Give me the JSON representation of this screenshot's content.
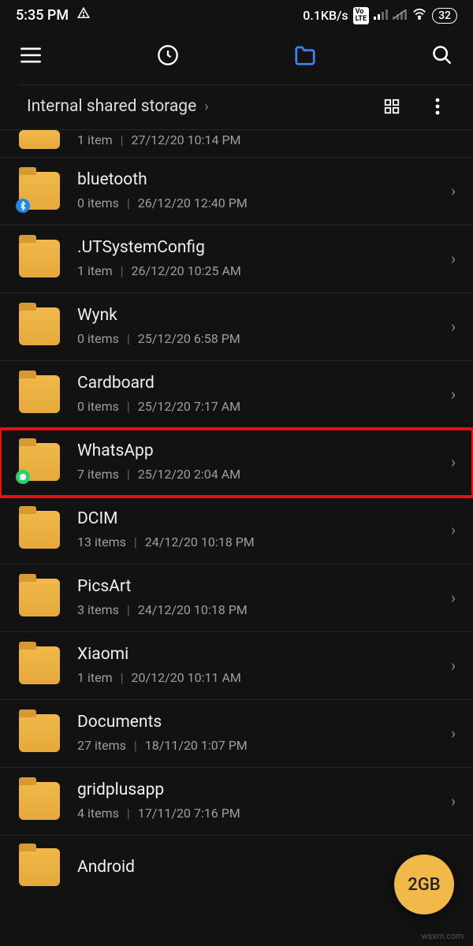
{
  "statusbar": {
    "time": "5:35 PM",
    "net_speed": "0.1KB/s",
    "battery": "32"
  },
  "breadcrumb": {
    "path": "Internal shared storage"
  },
  "items": [
    {
      "name": "",
      "meta_items": "1 item",
      "meta_date": "27/12/20 10:14 PM",
      "partial": true
    },
    {
      "name": "bluetooth",
      "meta_items": "0 items",
      "meta_date": "26/12/20 12:40 PM",
      "badge": "bt"
    },
    {
      "name": ".UTSystemConfig",
      "meta_items": "1 item",
      "meta_date": "26/12/20 10:25 AM"
    },
    {
      "name": "Wynk",
      "meta_items": "0 items",
      "meta_date": "25/12/20 6:58 PM"
    },
    {
      "name": "Cardboard",
      "meta_items": "0 items",
      "meta_date": "25/12/20 7:17 AM"
    },
    {
      "name": "WhatsApp",
      "meta_items": "7 items",
      "meta_date": "25/12/20 2:04 AM",
      "badge": "wa",
      "highlight": true
    },
    {
      "name": "DCIM",
      "meta_items": "13 items",
      "meta_date": "24/12/20 10:18 PM"
    },
    {
      "name": "PicsArt",
      "meta_items": "3 items",
      "meta_date": "24/12/20 10:18 PM"
    },
    {
      "name": "Xiaomi",
      "meta_items": "1 item",
      "meta_date": "20/12/20 10:11 AM"
    },
    {
      "name": "Documents",
      "meta_items": "27 items",
      "meta_date": "18/11/20 1:07 PM"
    },
    {
      "name": "gridplusapp",
      "meta_items": "4 items",
      "meta_date": "17/11/20 7:16 PM"
    },
    {
      "name": "Android",
      "meta_items": "",
      "meta_date": "",
      "cut": true
    }
  ],
  "fab": {
    "label": "2GB"
  },
  "watermark": "wsxm.com"
}
